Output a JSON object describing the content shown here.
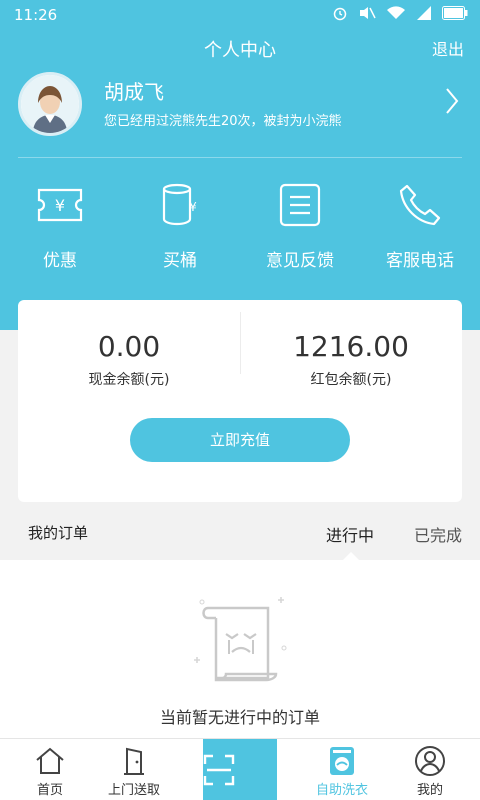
{
  "statusbar": {
    "time": "11:26"
  },
  "titlebar": {
    "title": "个人中心",
    "logout": "退出"
  },
  "profile": {
    "name": "胡成飞",
    "description": "您已经用过浣熊先生20次，被封为小浣熊"
  },
  "quick_actions": [
    {
      "label": "优惠",
      "icon": "coupon-icon"
    },
    {
      "label": "买桶",
      "icon": "bucket-icon"
    },
    {
      "label": "意见反馈",
      "icon": "feedback-icon"
    },
    {
      "label": "客服电话",
      "icon": "phone-icon"
    }
  ],
  "balance": {
    "cash_value": "0.00",
    "cash_label": "现金余额(元)",
    "redpacket_value": "1216.00",
    "redpacket_label": "红包余额(元)",
    "recharge_label": "立即充值"
  },
  "orders": {
    "title": "我的订单",
    "tab_active": "进行中",
    "tab_done": "已完成",
    "empty_message": "当前暂无进行中的订单"
  },
  "bottom_nav": [
    {
      "label": "首页",
      "icon": "home-icon"
    },
    {
      "label": "上门送取",
      "icon": "door-icon"
    },
    {
      "label": "",
      "icon": "scan-icon"
    },
    {
      "label": "自助洗衣",
      "icon": "washing-machine-icon"
    },
    {
      "label": "我的",
      "icon": "user-icon"
    }
  ],
  "colors": {
    "accent": "#4fc4e0",
    "background": "#f2f2f2"
  }
}
